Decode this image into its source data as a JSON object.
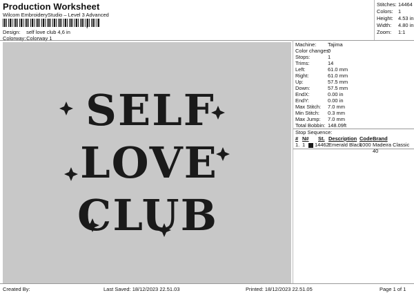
{
  "header": {
    "title": "Production Worksheet",
    "subtitle": "Wilcom EmbroideryStudio – Level 3 Advanced",
    "barcode_tail": ","
  },
  "meta": [
    {
      "label": "Design:",
      "value": "self love club 4,6 in"
    },
    {
      "label": "Colorway:",
      "value": "Colorway 1"
    }
  ],
  "summary": [
    {
      "label": "Stitches:",
      "value": "14464"
    },
    {
      "label": "Colors:",
      "value": "1"
    },
    {
      "label": "Height:",
      "value": "4.53 in"
    },
    {
      "label": "Width:",
      "value": "4.80 in"
    },
    {
      "label": "Zoom:",
      "value": "1:1"
    }
  ],
  "design": {
    "words": [
      "SELF",
      "LOVE",
      "CLUB"
    ],
    "thread_color": "#1a1a1a",
    "background": "#c8c8c8"
  },
  "machine_info": [
    {
      "label": "Machine:",
      "value": "Tajima"
    },
    {
      "label": "Color changes:",
      "value": "0"
    },
    {
      "label": "Stops:",
      "value": "1"
    },
    {
      "label": "Trims:",
      "value": "14"
    },
    {
      "label": "Left:",
      "value": "61.0 mm"
    },
    {
      "label": "Right:",
      "value": "61.0 mm"
    },
    {
      "label": "Up:",
      "value": "57.5 mm"
    },
    {
      "label": "Down:",
      "value": "57.5 mm"
    },
    {
      "label": "EndX:",
      "value": "0.00 in"
    },
    {
      "label": "EndY:",
      "value": "0.00 in"
    },
    {
      "label": "Max Stitch:",
      "value": "7.0 mm"
    },
    {
      "label": "Min Stitch:",
      "value": "0.3 mm"
    },
    {
      "label": "Max Jump:",
      "value": "7.0 mm"
    },
    {
      "label": "Total Bobbin:",
      "value": "148.09ft"
    }
  ],
  "stop_sequence": {
    "title": "Stop Sequence:",
    "headers": [
      "#",
      "N#",
      "",
      "St.",
      "Description",
      "Code",
      "Brand"
    ],
    "rows": [
      {
        "num": "1.",
        "needle": "1",
        "stitches": "14462",
        "description": "Emerald Black",
        "code": "1000",
        "brand": "Madeira Classic 40",
        "color": "#1a1a1a"
      }
    ]
  },
  "footer": {
    "created_by": "Created By:",
    "last_saved": "Last Saved: 18/12/2023 22.51.03",
    "printed": "Printed: 18/12/2023 22.51.05",
    "page": "Page 1 of 1"
  }
}
